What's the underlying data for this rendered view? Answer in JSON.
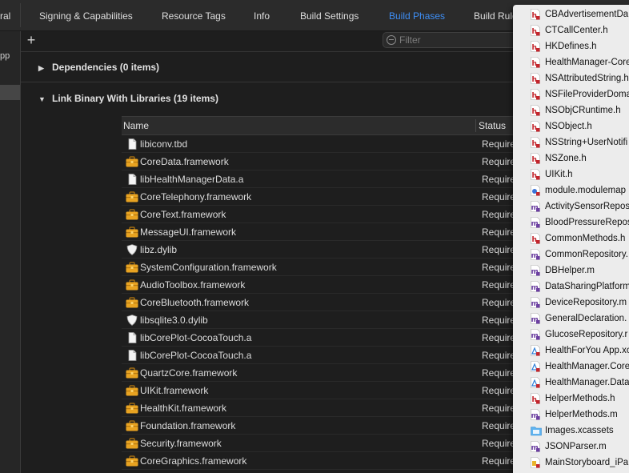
{
  "tabs": [
    {
      "label": "ral",
      "active": false
    },
    {
      "label": "Signing & Capabilities",
      "active": false
    },
    {
      "label": "Resource Tags",
      "active": false
    },
    {
      "label": "Info",
      "active": false
    },
    {
      "label": "Build Settings",
      "active": false
    },
    {
      "label": "Build Phases",
      "active": true
    },
    {
      "label": "Build Rule",
      "active": false
    }
  ],
  "sidebar": {
    "truncated_label": "pp"
  },
  "toolbar": {
    "add_icon": "plus-icon",
    "filter_placeholder": "Filter"
  },
  "sections": {
    "dependencies": {
      "title": "Dependencies (0 items)",
      "expanded": false
    },
    "link_binary": {
      "title": "Link Binary With Libraries (19 items)",
      "expanded": true
    }
  },
  "table": {
    "columns": {
      "name": "Name",
      "status": "Status"
    },
    "rows": [
      {
        "name": "libiconv.tbd",
        "status": "Require",
        "icon": "document"
      },
      {
        "name": "CoreData.framework",
        "status": "Require",
        "icon": "toolbox"
      },
      {
        "name": "libHealthManagerData.a",
        "status": "Require",
        "icon": "document"
      },
      {
        "name": "CoreTelephony.framework",
        "status": "Require",
        "icon": "toolbox"
      },
      {
        "name": "CoreText.framework",
        "status": "Require",
        "icon": "toolbox"
      },
      {
        "name": "MessageUI.framework",
        "status": "Require",
        "icon": "toolbox"
      },
      {
        "name": "libz.dylib",
        "status": "Require",
        "icon": "shield"
      },
      {
        "name": "SystemConfiguration.framework",
        "status": "Require",
        "icon": "toolbox"
      },
      {
        "name": "AudioToolbox.framework",
        "status": "Require",
        "icon": "toolbox"
      },
      {
        "name": "CoreBluetooth.framework",
        "status": "Require",
        "icon": "toolbox"
      },
      {
        "name": "libsqlite3.0.dylib",
        "status": "Require",
        "icon": "shield"
      },
      {
        "name": "libCorePlot-CocoaTouch.a",
        "status": "Require",
        "icon": "document"
      },
      {
        "name": "libCorePlot-CocoaTouch.a",
        "status": "Require",
        "icon": "document"
      },
      {
        "name": "QuartzCore.framework",
        "status": "Require",
        "icon": "toolbox"
      },
      {
        "name": "UIKit.framework",
        "status": "Require",
        "icon": "toolbox"
      },
      {
        "name": "HealthKit.framework",
        "status": "Require",
        "icon": "toolbox"
      },
      {
        "name": "Foundation.framework",
        "status": "Require",
        "icon": "toolbox"
      },
      {
        "name": "Security.framework",
        "status": "Require",
        "icon": "toolbox"
      },
      {
        "name": "CoreGraphics.framework",
        "status": "Require",
        "icon": "toolbox"
      }
    ]
  },
  "file_popup": {
    "items": [
      {
        "label": "CBAdvertisementDa",
        "icon": "header-file"
      },
      {
        "label": "CTCallCenter.h",
        "icon": "header-file"
      },
      {
        "label": "HKDefines.h",
        "icon": "header-file"
      },
      {
        "label": "HealthManager-Core",
        "icon": "header-file"
      },
      {
        "label": "NSAttributedString.h",
        "icon": "header-file"
      },
      {
        "label": "NSFileProviderDoma",
        "icon": "header-file"
      },
      {
        "label": "NSObjCRuntime.h",
        "icon": "header-file"
      },
      {
        "label": "NSObject.h",
        "icon": "header-file"
      },
      {
        "label": "NSString+UserNotifi",
        "icon": "header-file"
      },
      {
        "label": "NSZone.h",
        "icon": "header-file"
      },
      {
        "label": "UIKit.h",
        "icon": "header-file"
      },
      {
        "label": "module.modulemap",
        "icon": "modulemap-file"
      },
      {
        "label": "ActivitySensorRepos",
        "icon": "objc-file"
      },
      {
        "label": "BloodPressureRepos",
        "icon": "objc-file"
      },
      {
        "label": "CommonMethods.h",
        "icon": "header-file"
      },
      {
        "label": "CommonRepository.",
        "icon": "objc-file"
      },
      {
        "label": "DBHelper.m",
        "icon": "objc-file"
      },
      {
        "label": "DataSharingPlatform",
        "icon": "objc-file"
      },
      {
        "label": "DeviceRepository.m",
        "icon": "objc-file"
      },
      {
        "label": "GeneralDeclaration.",
        "icon": "objc-file"
      },
      {
        "label": "GlucoseRepository.r",
        "icon": "objc-file"
      },
      {
        "label": "HealthForYou App.xc",
        "icon": "model-file"
      },
      {
        "label": "HealthManager.Core",
        "icon": "model-file"
      },
      {
        "label": "HealthManager.Data",
        "icon": "model-file"
      },
      {
        "label": "HelperMethods.h",
        "icon": "header-file"
      },
      {
        "label": "HelperMethods.m",
        "icon": "objc-file"
      },
      {
        "label": "Images.xcassets",
        "icon": "folder-assets"
      },
      {
        "label": "JSONParser.m",
        "icon": "objc-file"
      },
      {
        "label": "MainStoryboard_iPa",
        "icon": "storyboard-file"
      }
    ]
  },
  "colors": {
    "accent": "#3e8ff7",
    "background": "#1e1e1e",
    "popup_background": "#ececec",
    "header_icon": "#c2252c",
    "objc_icon": "#6b3ea0",
    "toolbox_icon": "#e8a321"
  }
}
